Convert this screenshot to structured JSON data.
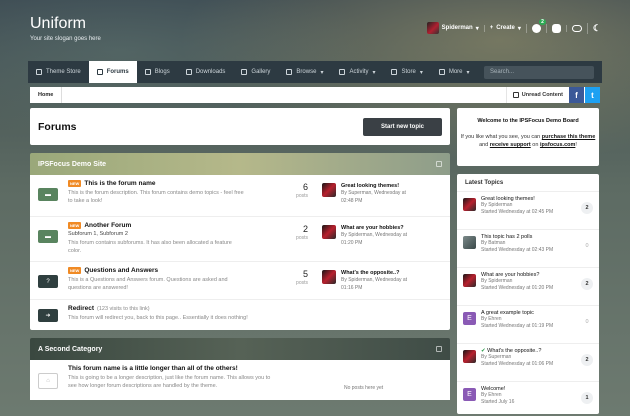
{
  "header": {
    "title": "Uniform",
    "slogan": "Your site slogan goes here",
    "user": "Spiderman",
    "create": "Create",
    "notif_count": "2"
  },
  "nav": [
    {
      "label": "Theme Store"
    },
    {
      "label": "Forums",
      "active": true
    },
    {
      "label": "Blogs"
    },
    {
      "label": "Downloads"
    },
    {
      "label": "Gallery"
    },
    {
      "label": "Browse"
    },
    {
      "label": "Activity"
    },
    {
      "label": "Store"
    },
    {
      "label": "More"
    }
  ],
  "search": {
    "placeholder": "Search..."
  },
  "breadcrumb": {
    "home": "Home",
    "unread": "Unread Content"
  },
  "page": {
    "title": "Forums",
    "start_button": "Start new topic"
  },
  "categories": [
    {
      "name": "IPSFocus Demo Site",
      "forums": [
        {
          "new": "NEW",
          "title": "This is the forum name",
          "desc": "This is the forum description. This forum contains demo topics - feel free to take a look!",
          "subs": "",
          "posts": "6",
          "posts_label": "posts",
          "last_title": "Great looking themes!",
          "last_by": "By Superman, Wednesday at",
          "last_time": "02:48 PM"
        },
        {
          "new": "NEW",
          "title": "Another Forum",
          "desc": "This forum contains subforums. It has also been allocated a feature color.",
          "subs": "Subforum 1,   Subforum 2",
          "posts": "2",
          "posts_label": "posts",
          "last_title": "What are your hobbies?",
          "last_by": "By Spiderman, Wednesday at",
          "last_time": "01:20 PM"
        },
        {
          "new": "NEW",
          "title": "Questions and Answers",
          "desc": "This is a Questions and Answers forum. Questions are asked and questions are answered!",
          "subs": "",
          "posts": "5",
          "posts_label": "posts",
          "last_title": "What's the opposite..?",
          "last_by": "By Spiderman, Wednesday at",
          "last_time": "01:16 PM"
        },
        {
          "new": "",
          "title": "Redirect",
          "desc": "This forum will redirect you, back to this page.. Essentially it does nothing!",
          "subs": "(123 visits to this link)",
          "posts": "",
          "posts_label": "",
          "last_title": "",
          "last_by": "",
          "last_time": ""
        }
      ]
    },
    {
      "name": "A Second Category",
      "forums": [
        {
          "new": "",
          "title": "This forum name is a little longer than all of the others!",
          "desc": "This is going to be a longer description, just like the forum name. This allows you to see how longer forum descriptions are handled by the theme.",
          "subs": "",
          "posts": "",
          "posts_label": "",
          "last_title": "No posts here yet",
          "last_by": "",
          "last_time": ""
        }
      ]
    }
  ],
  "welcome": {
    "line1": "Welcome to the IPSFocus Demo Board",
    "line2": "If you like what you see, you can",
    "purchase": "purchase this theme",
    "and": "and",
    "support": "receive support",
    "on": "on",
    "site": "ipsfocus.com",
    "excl": "!"
  },
  "latest": {
    "heading": "Latest Topics",
    "items": [
      {
        "title": "Great looking themes!",
        "by": "By Spiderman",
        "started": "Started Wednesday at 02:45 PM",
        "count": "2",
        "avatar": "spider"
      },
      {
        "title": "This topic has 2 polls",
        "by": "By Batman",
        "started": "Started Wednesday at 02:43 PM",
        "count": "0",
        "avatar": "batman"
      },
      {
        "title": "What are your hobbies?",
        "by": "By Spiderman",
        "started": "Started Wednesday at 01:20 PM",
        "count": "2",
        "avatar": "spider"
      },
      {
        "title": "A great example topic",
        "by": "By Ehren",
        "started": "Started Wednesday at 01:19 PM",
        "count": "0",
        "avatar": "E"
      },
      {
        "title": "What's the opposite..?",
        "by": "By Superman",
        "started": "Started Wednesday at 01:06 PM",
        "count": "2",
        "avatar": "spider",
        "solved": true
      },
      {
        "title": "Welcome!",
        "by": "By Ehren",
        "started": "Started July 16",
        "count": "1",
        "avatar": "E"
      }
    ]
  },
  "colors": {
    "nav": "#2d3a42",
    "forum_icon": "#59845f",
    "new_badge": "#f08a24",
    "facebook": "#3b5998",
    "twitter": "#1da1f2"
  }
}
